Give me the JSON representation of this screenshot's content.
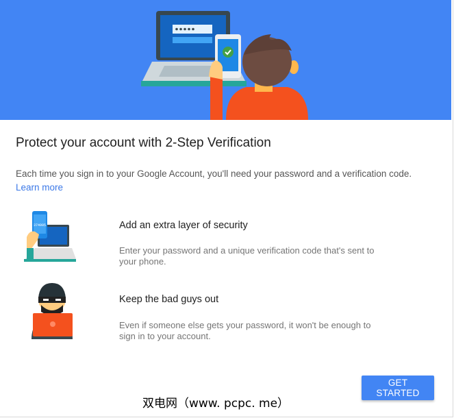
{
  "hero": {
    "illustration": "laptop-password-phone-checkmark-person"
  },
  "title": "Protect your account with 2-Step Verification",
  "description": "Each time you sign in to your Google Account, you'll need your password and a verification code.",
  "learn_more": "Learn more",
  "features": [
    {
      "icon": "phone-code-laptop-icon",
      "title": "Add an extra layer of security",
      "desc": "Enter your password and a unique verification code that's sent to your phone.",
      "phone_code": "374005"
    },
    {
      "icon": "masked-hacker-icon",
      "title": "Keep the bad guys out",
      "desc": "Even if someone else gets your password, it won't be enough to sign in to your account."
    }
  ],
  "button": {
    "label": "GET STARTED"
  },
  "watermark": "双电网（www. pcpc. me）",
  "colors": {
    "hero_bg": "#4285f4",
    "button_bg": "#4285f4",
    "link": "#3b78e7",
    "shirt": "#f4511e"
  }
}
